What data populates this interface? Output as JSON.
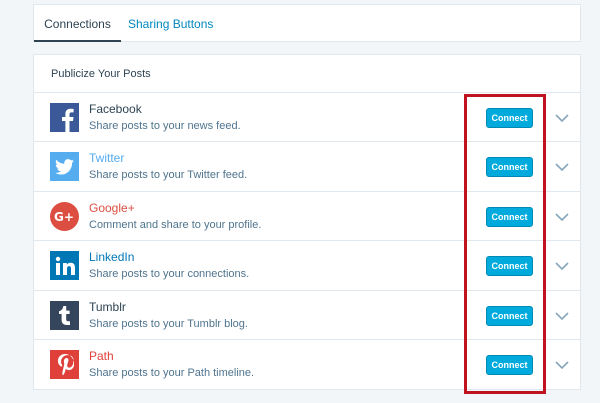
{
  "tabs": [
    {
      "label": "Connections",
      "active": true
    },
    {
      "label": "Sharing Buttons",
      "active": false
    }
  ],
  "panel": {
    "title": "Publicize Your Posts",
    "connect_label": "Connect",
    "services": [
      {
        "name": "Facebook",
        "description": "Share posts to your news feed.",
        "icon": "facebook-icon",
        "color": "#3b5998",
        "name_color": "#2e4453"
      },
      {
        "name": "Twitter",
        "description": "Share posts to your Twitter feed.",
        "icon": "twitter-icon",
        "color": "#55acee",
        "name_color": "#55acee"
      },
      {
        "name": "Google+",
        "description": "Comment and share to your profile.",
        "icon": "google-plus-icon",
        "color": "#dc4e41",
        "name_color": "#dc4e41"
      },
      {
        "name": "LinkedIn",
        "description": "Share posts to your connections.",
        "icon": "linkedin-icon",
        "color": "#0077b5",
        "name_color": "#0077b5"
      },
      {
        "name": "Tumblr",
        "description": "Share posts to your Tumblr blog.",
        "icon": "tumblr-icon",
        "color": "#35465c",
        "name_color": "#2e4453"
      },
      {
        "name": "Path",
        "description": "Share posts to your Path timeline.",
        "icon": "path-icon",
        "color": "#e0403a",
        "name_color": "#e0403a"
      }
    ]
  },
  "colors": {
    "accent": "#00aadc",
    "highlight": "#c1121f"
  }
}
